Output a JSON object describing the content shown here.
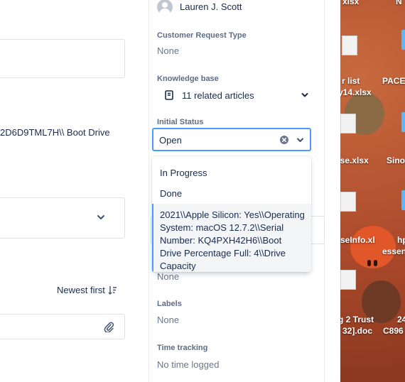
{
  "left": {
    "serial_text": "2D6D9TML7H\\\\ Boot Drive",
    "sort_label": "Newest first",
    "icons": {
      "sort": "sort-descending-icon",
      "attach": "paperclip-icon",
      "chevron": "chevron-down-icon"
    }
  },
  "sidebar": {
    "assignee_name": "Lauren J. Scott",
    "request_type_label": "Customer Request Type",
    "request_type_value": "None",
    "kb_label": "Knowledge base",
    "kb_value": "11 related articles",
    "status_label": "Initial Status",
    "status_value": "Open",
    "options": [
      "In Progress",
      "Done",
      "2021\\\\Apple Silicon: Yes\\\\Operating System: macOS 12.7.2\\\\Serial Number: KQ4PXH42H6\\\\Boot Drive Percentage Full: 4\\\\Drive Capacity"
    ],
    "hidden_value": "None",
    "labels_label": "Labels",
    "labels_value": "None",
    "time_label": "Time tracking",
    "time_value": "No time logged"
  },
  "desktop": {
    "labels": [
      "xlsx",
      "N",
      "r list",
      "PACE",
      "y14.xlsx",
      "ase.xlsx",
      "Sino",
      "seInfo.xl",
      "hp",
      "essen",
      "g 2 Trust",
      "24",
      "32].doc",
      "C896"
    ]
  },
  "colors": {
    "accent": "#4c9aff",
    "text": "#172b4d",
    "muted": "#6b778c",
    "desktop_bg": "#b8552f"
  }
}
